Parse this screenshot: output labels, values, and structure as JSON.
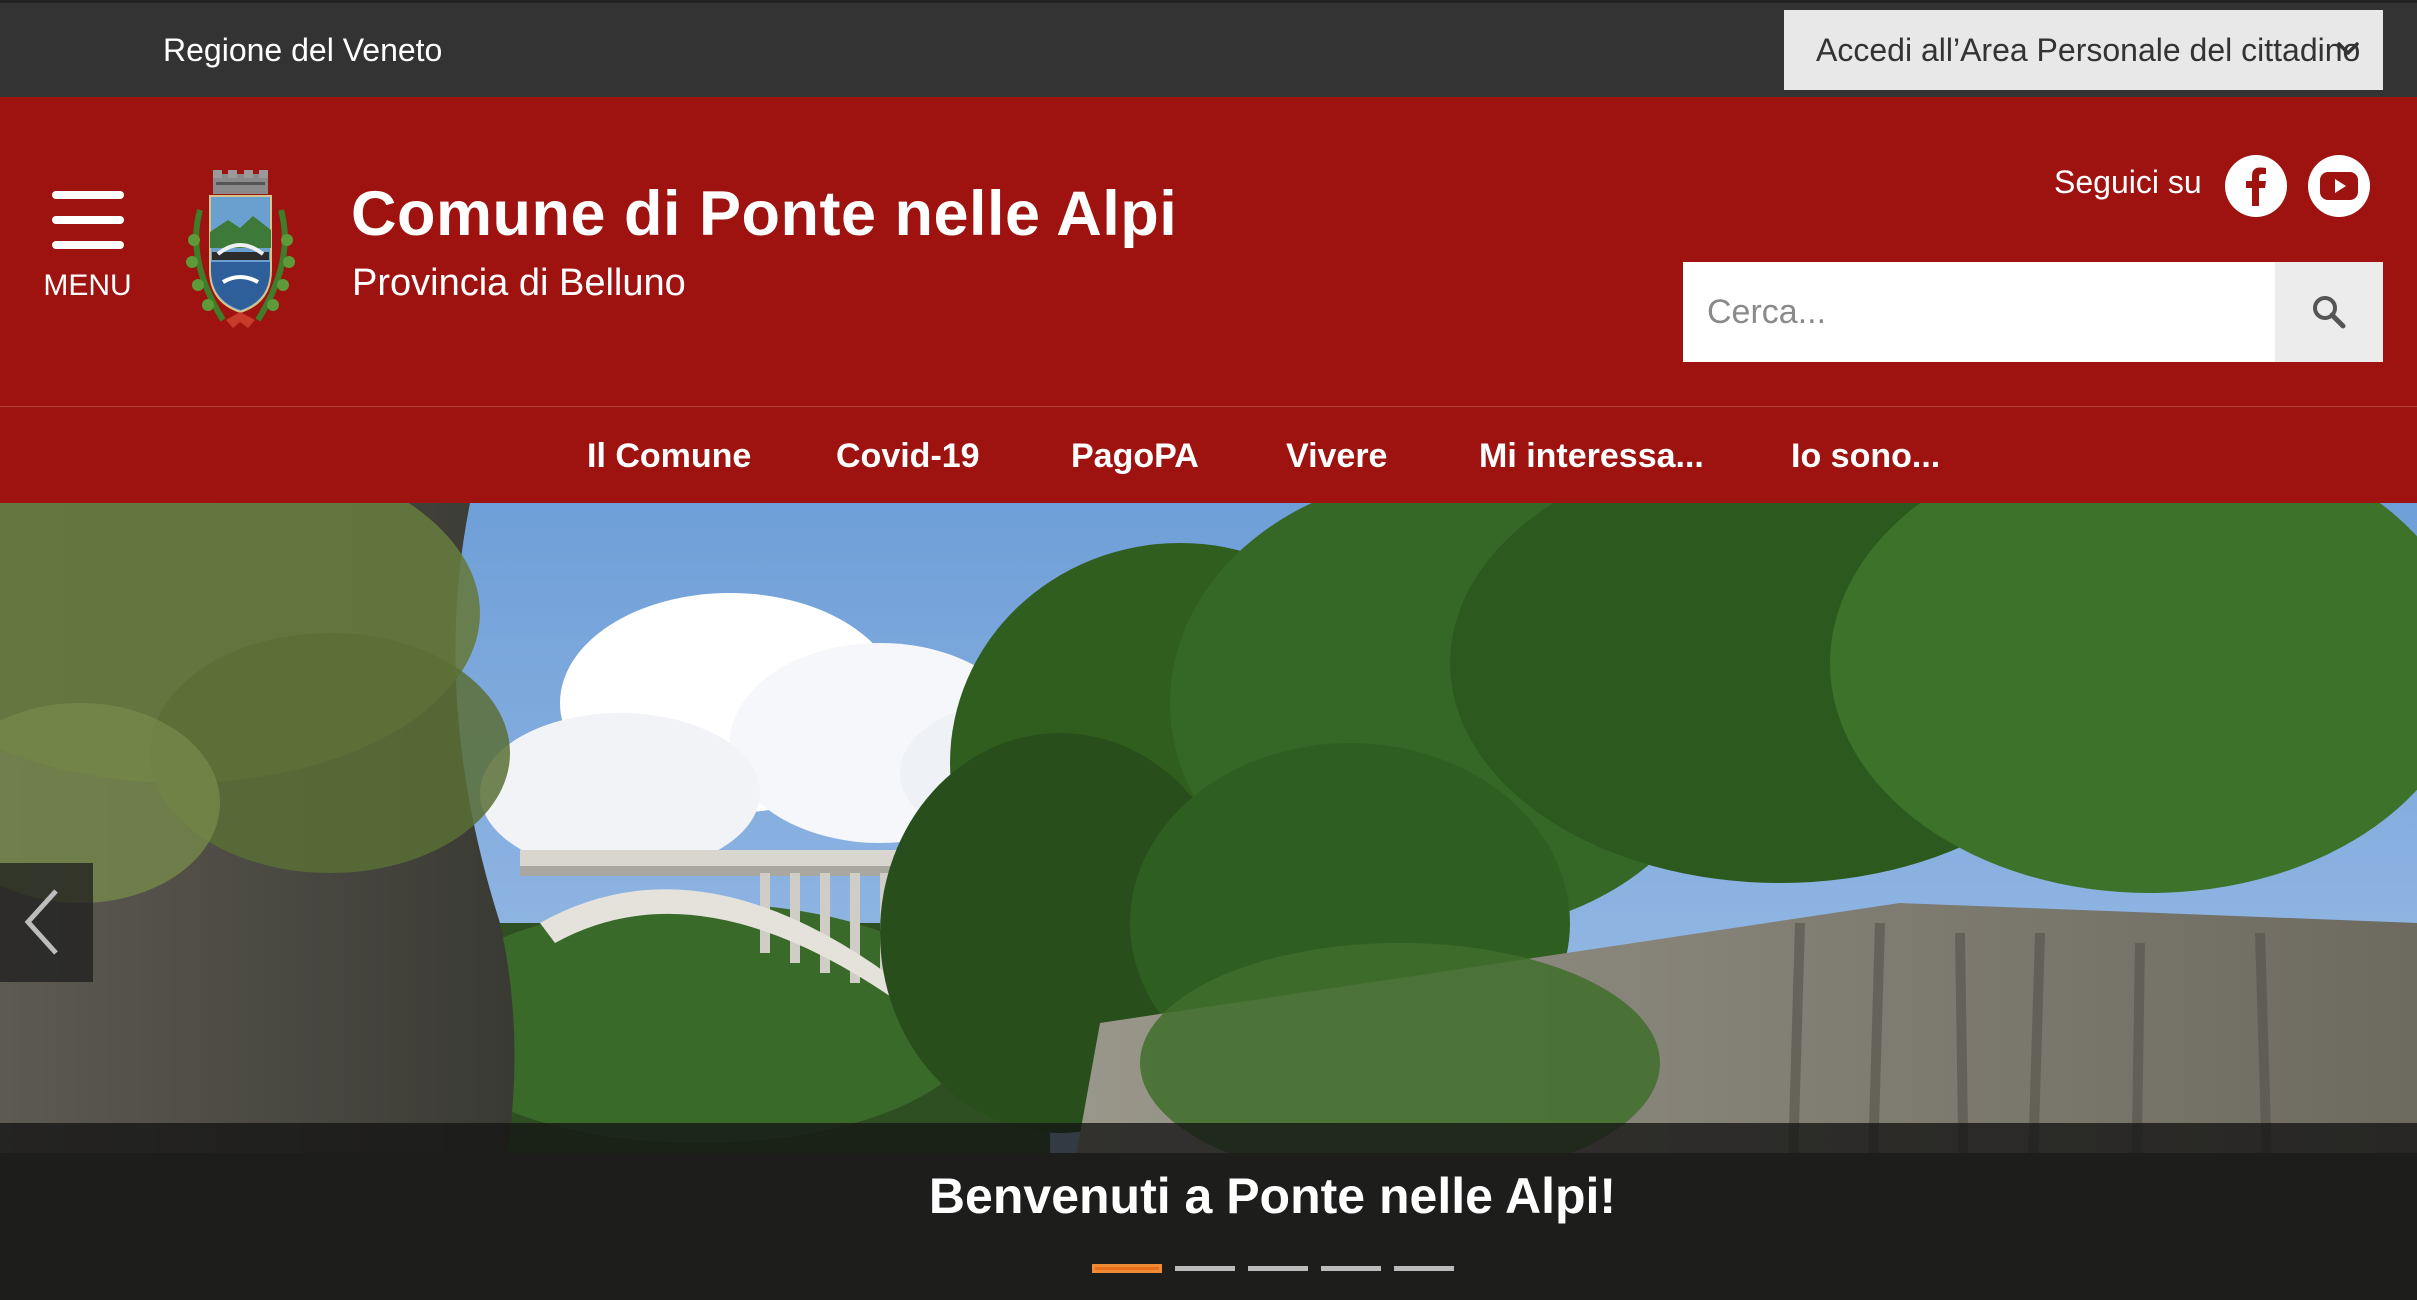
{
  "topbar": {
    "region": "Regione del Veneto",
    "login": "Accedi all’Area Personale del cittadino"
  },
  "header": {
    "menu_label": "MENU",
    "title": "Comune di Ponte nelle Alpi",
    "subtitle": "Provincia di Belluno",
    "follow_label": "Seguici su",
    "search_placeholder": "Cerca..."
  },
  "nav": {
    "items": [
      {
        "label": "Il Comune"
      },
      {
        "label": "Covid-19"
      },
      {
        "label": "PagoPA"
      },
      {
        "label": "Vivere"
      },
      {
        "label": "Mi interessa..."
      },
      {
        "label": "Io sono..."
      }
    ]
  },
  "hero": {
    "caption": "Benvenuti a Ponte nelle Alpi!",
    "slide_count": 5,
    "active_slide": 1
  },
  "colors": {
    "brand_red": "#9e1310",
    "topbar": "#333333",
    "indicator_active": "#e8701a"
  },
  "icons": [
    "hamburger-icon",
    "chevron-down-icon",
    "facebook-icon",
    "youtube-icon",
    "search-icon",
    "chevron-left-icon"
  ]
}
